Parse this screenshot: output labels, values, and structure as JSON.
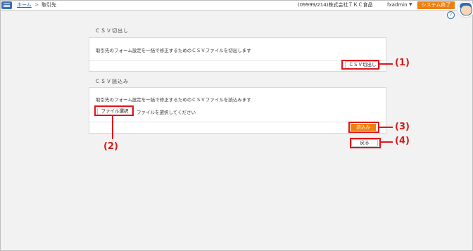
{
  "header": {
    "breadcrumb_home": "ホーム",
    "breadcrumb_sep": ">",
    "breadcrumb_current": "取引先",
    "company": "(09999/214)株式会社ＴＫＣ食品",
    "user": "fxadmin",
    "user_caret": "▼",
    "exit_label": "システム終了",
    "help_label": "?"
  },
  "export_section": {
    "title": "ＣＳＶ切出し",
    "description": "取引先のフォーム設定を一括で修正するためのＣＳＶファイルを切出します",
    "button_label": "ＣＳＶ切出し"
  },
  "import_section": {
    "title": "ＣＳＶ読込み",
    "description": "取引先のフォーム設定を一括で修正するためのＣＳＶファイルを読込みます",
    "file_button_label": "ファイル選択",
    "file_placeholder": "ファイルを選択してください",
    "import_button_label": "読込み"
  },
  "back_button_label": "戻る",
  "callouts": {
    "c1": "(1)",
    "c2": "(2)",
    "c3": "(3)",
    "c4": "(4)"
  },
  "colors": {
    "accent_orange": "#f07f0c",
    "callout_red": "#e0151b",
    "link_blue": "#2a5db0",
    "menu_blue": "#3b6fb3"
  }
}
